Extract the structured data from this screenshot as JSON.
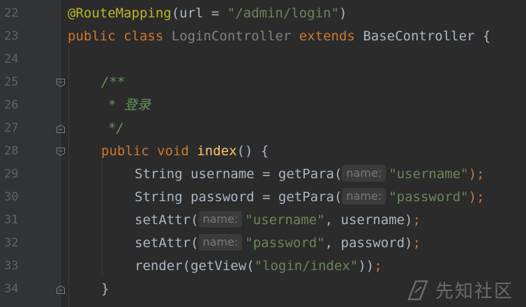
{
  "editor": {
    "lines": [
      {
        "n": "22"
      },
      {
        "n": "23"
      },
      {
        "n": "24"
      },
      {
        "n": "25"
      },
      {
        "n": "26"
      },
      {
        "n": "27"
      },
      {
        "n": "28"
      },
      {
        "n": "29"
      },
      {
        "n": "30"
      },
      {
        "n": "31"
      },
      {
        "n": "32"
      },
      {
        "n": "33"
      },
      {
        "n": "34"
      }
    ],
    "code": {
      "l22_ann": "@RouteMapping",
      "l22_args": "(url = ",
      "l22_str": "\"/admin/login\"",
      "l22_close": ")",
      "l23_public": "public",
      "l23_class": "class",
      "l23_name": "LoginController",
      "l23_extends": "extends",
      "l23_base": "BaseController {",
      "l25_cmt": "/**",
      "l26_cmt": "* 登录",
      "l27_cmt": "*/",
      "l28_public": "public",
      "l28_void": "void",
      "l28_fn": "index",
      "l28_rest": "() {",
      "l29_a": "String username = getPara(",
      "l29_hint": "name:",
      "l29_str": "\"username\"",
      "l29_end": ");",
      "l30_a": "String password = getPara(",
      "l30_hint": "name:",
      "l30_str": "\"password\"",
      "l30_end": ");",
      "l31_a": "setAttr(",
      "l31_hint": "name:",
      "l31_str": "\"username\"",
      "l31_rest": ", username)",
      "l31_semi": ";",
      "l32_a": "setAttr(",
      "l32_hint": "name:",
      "l32_str": "\"password\"",
      "l32_rest": ", password)",
      "l32_semi": ";",
      "l33_a": "render(getView(",
      "l33_str": "\"login/index\"",
      "l33_rest": "))",
      "l33_semi": ";",
      "l34": "}"
    }
  },
  "watermark": {
    "text": "先知社区",
    "icon": "xianzhi-logo-icon"
  },
  "colors": {
    "background": "#2b2b2b",
    "gutter": "#313335",
    "keyword": "#cc7832",
    "annotation": "#bbb529",
    "string": "#6a8759",
    "function": "#ffc66d",
    "comment": "#629755",
    "text": "#a9b7c6",
    "line_number": "#606366"
  }
}
